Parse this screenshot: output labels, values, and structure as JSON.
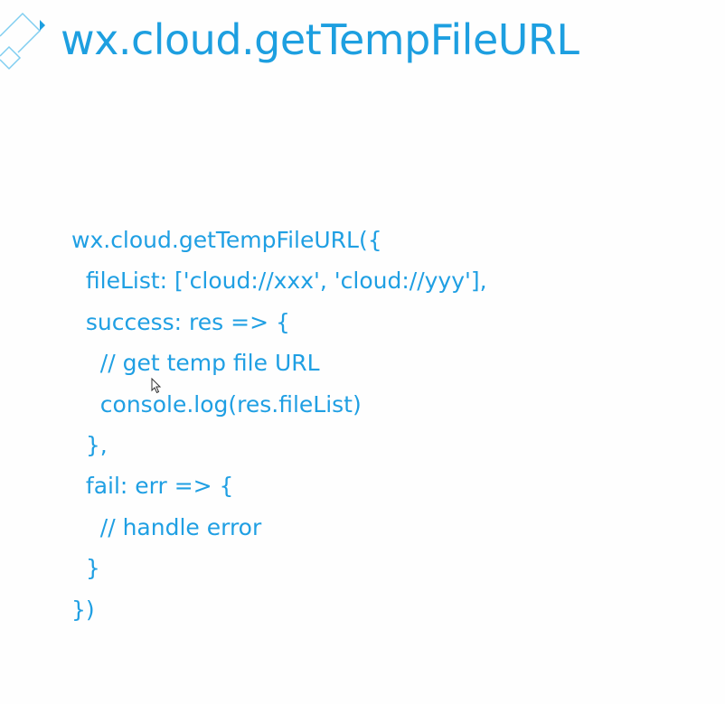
{
  "slide": {
    "title": "wx.cloud.getTempFileURL",
    "code_lines": [
      "wx.cloud.getTempFileURL({",
      "  fileList: ['cloud://xxx', 'cloud://yyy'],",
      "  success: res => {",
      "    // get temp file URL",
      "    console.log(res.fileList)",
      "  },",
      "  fail: err => {",
      "    // handle error",
      "  }",
      "})"
    ]
  },
  "colors": {
    "accent": "#1d9fe0",
    "background": "#fefefe"
  },
  "icons": {
    "corner": "diamond-outline-decoration",
    "cursor": "mouse-pointer"
  }
}
